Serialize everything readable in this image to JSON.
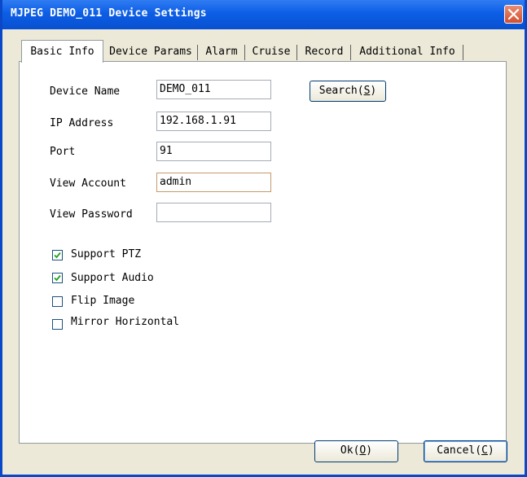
{
  "window": {
    "title": "MJPEG DEMO_011 Device Settings"
  },
  "tabs": [
    {
      "label": "Basic Info",
      "active": true
    },
    {
      "label": "Device Params"
    },
    {
      "label": "Alarm"
    },
    {
      "label": "Cruise"
    },
    {
      "label": "Record"
    },
    {
      "label": "Additional Info"
    }
  ],
  "form": {
    "device_name": {
      "label": "Device Name",
      "value": "DEMO_011"
    },
    "ip_address": {
      "label": "IP Address",
      "value": "192.168.1.91"
    },
    "port": {
      "label": "Port",
      "value": "91"
    },
    "view_account": {
      "label": "View Account",
      "value": "admin"
    },
    "view_password": {
      "label": "View Password",
      "value": ""
    }
  },
  "search_button": {
    "label": "Search",
    "mnemonic": "S"
  },
  "checkboxes": [
    {
      "label": "Support PTZ",
      "checked": true
    },
    {
      "label": "Support Audio",
      "checked": true
    },
    {
      "label": "Flip Image",
      "checked": false
    },
    {
      "label": "Mirror Horizontal",
      "checked": false
    }
  ],
  "buttons": {
    "ok": {
      "label": "Ok",
      "mnemonic": "O"
    },
    "cancel": {
      "label": "Cancel",
      "mnemonic": "C"
    }
  },
  "colors": {
    "title_bar": "#0d5ee6",
    "close_button": "#d24f2e",
    "check_mark": "#21a121"
  }
}
